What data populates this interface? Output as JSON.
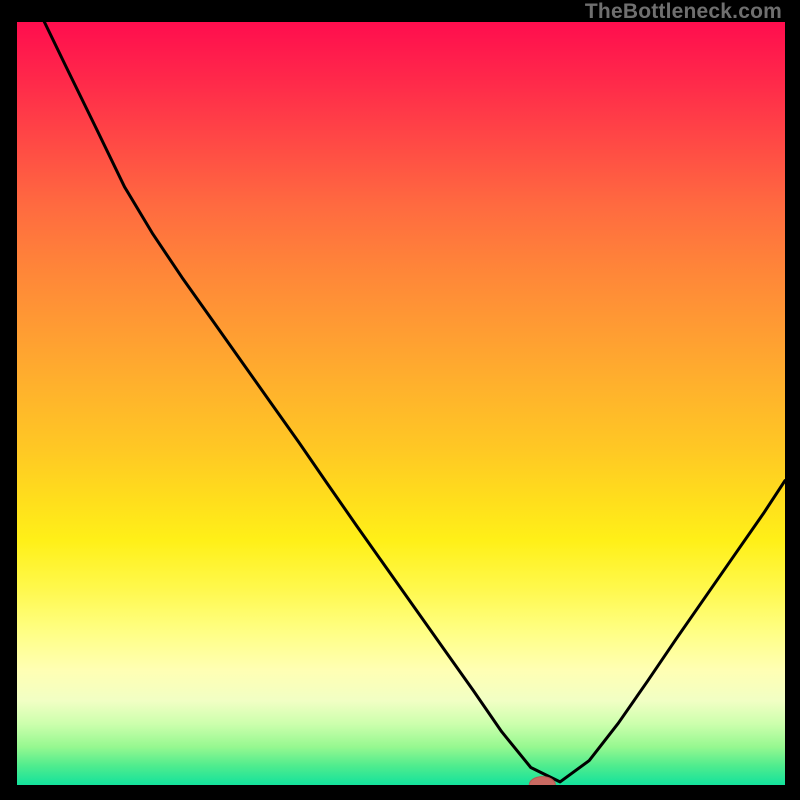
{
  "watermark": "TheBottleneck.com",
  "colors": {
    "curve_stroke": "#000000",
    "marker_fill": "#c96a62",
    "marker_stroke": "#b55a52",
    "background": "#000000"
  },
  "chart_data": {
    "type": "line",
    "title": "",
    "xlabel": "",
    "ylabel": "",
    "xlim": [
      0,
      100
    ],
    "ylim": [
      0,
      100
    ],
    "grid": false,
    "series": [
      {
        "name": "bottleneck-curve",
        "x": [
          2.6,
          6.4,
          10.2,
          14.0,
          17.7,
          21.5,
          25.3,
          29.1,
          32.9,
          36.7,
          40.4,
          44.2,
          48.0,
          51.8,
          55.6,
          59.4,
          63.1,
          66.9,
          70.7,
          74.5,
          78.3,
          82.1,
          85.8,
          89.6,
          93.4,
          97.2,
          100.0
        ],
        "values": [
          102.0,
          94.1,
          86.3,
          78.4,
          72.2,
          66.5,
          61.1,
          55.7,
          50.3,
          44.9,
          39.5,
          34.0,
          28.6,
          23.2,
          17.8,
          12.4,
          7.0,
          2.3,
          0.4,
          3.2,
          8.1,
          13.6,
          19.1,
          24.6,
          30.1,
          35.6,
          39.9
        ]
      }
    ],
    "marker": {
      "x": 68.4,
      "y": 0.0,
      "rx": 1.7,
      "ry": 1.1
    }
  }
}
